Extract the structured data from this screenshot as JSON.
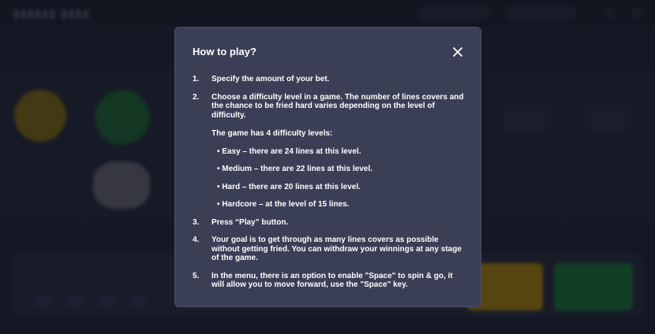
{
  "modal": {
    "title": "How to play?",
    "steps": [
      {
        "num": "1.",
        "text": "Specify the amount of your bet."
      },
      {
        "num": "2.",
        "text": "Choose a difficulty level in a game. The number of lines covers and the chance to be fried hard varies depending on the level of difficulty."
      },
      {
        "num": "3.",
        "text": "Press  “Play” button."
      },
      {
        "num": "4.",
        "text": "Your goal is to get through as many lines covers as possible without getting fried. You can withdraw your winnings at any stage of the game."
      },
      {
        "num": "5.",
        "text": "In the menu, there is an option to enable \"Space\" to spin & go, it will allow you to move forward, use the \"Space\" key."
      }
    ],
    "levels_title": "The game has 4 difficulty levels:",
    "levels": [
      "• Easy – there are 24 lines at this level.",
      "• Medium – there are 22 lines at this level.",
      "• Hard – there are 20 lines at this level.",
      "• Hardcore – at the level of 15 lines."
    ]
  },
  "colors": {
    "modal_bg": "#3a3f56",
    "page_bg": "#1d202c",
    "accent_yellow": "#b48a0c",
    "accent_green": "#1f7a3c"
  }
}
